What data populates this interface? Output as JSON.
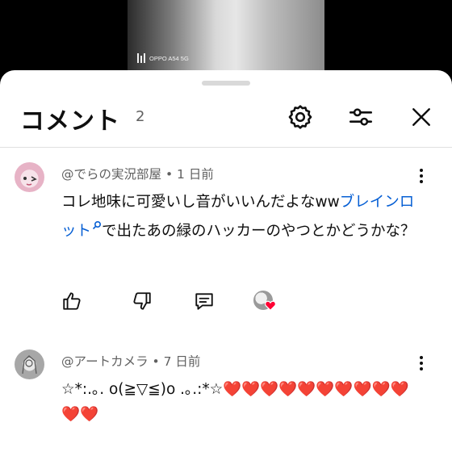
{
  "video": {
    "watermark": "OPPO A54 5G"
  },
  "header": {
    "title": "コメント",
    "count": "2",
    "icons": [
      "settings-icon",
      "filter-icon",
      "close-icon"
    ]
  },
  "comments": [
    {
      "author": "@でらの実況部屋",
      "time": "1 日前",
      "text_before": "コレ地味に可愛いし音がいいんだよなww",
      "link_text": "ブレインロット",
      "text_after": "で出たあの緑のハッカーのやつとかどうかな？"
    },
    {
      "author": "@アートカメラ",
      "time": "7 日前",
      "text": "☆*:.｡. o(≧▽≦)o .｡.:*☆❤️❤️❤️❤️❤️❤️❤️❤️❤️❤️❤️❤️"
    }
  ],
  "separator": "•",
  "colors": {
    "link": "#065fd4",
    "heart": "#ff0033",
    "meta": "#606060"
  }
}
